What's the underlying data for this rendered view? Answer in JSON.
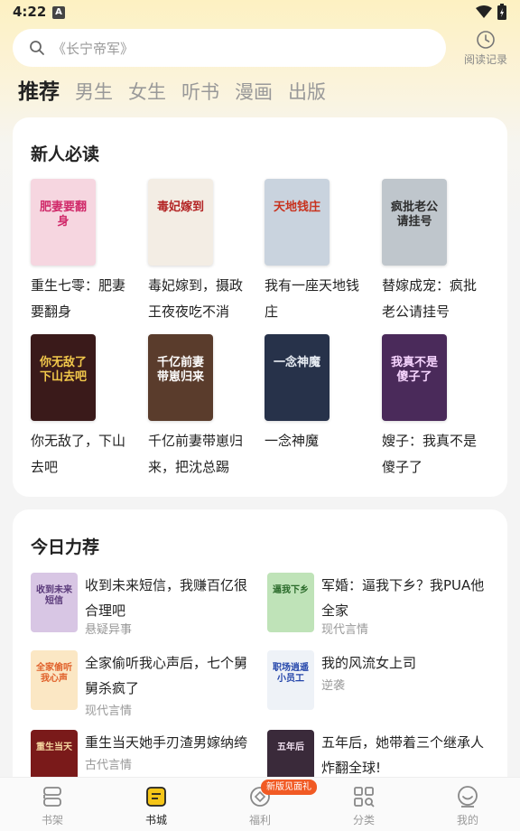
{
  "status": {
    "time": "4:22",
    "notif": "A"
  },
  "search": {
    "placeholder": "《长宁帝军》"
  },
  "history": {
    "label": "阅读记录"
  },
  "channels": [
    "推荐",
    "男生",
    "女生",
    "听书",
    "漫画",
    "出版"
  ],
  "new_reader": {
    "title": "新人必读",
    "books": [
      {
        "title": "重生七零：肥妻要翻身",
        "cover_text": "肥妻要翻身",
        "bg": "#f6d6e0",
        "fg": "#d02a6a"
      },
      {
        "title": "毒妃嫁到，摄政王夜夜吃不消",
        "cover_text": "毒妃嫁到",
        "bg": "#f3ede4",
        "fg": "#b32424"
      },
      {
        "title": "我有一座天地钱庄",
        "cover_text": "天地钱庄",
        "bg": "#c9d3de",
        "fg": "#c8321e"
      },
      {
        "title": "替嫁成宠：疯批老公请挂号",
        "cover_text": "疯批老公请挂号",
        "bg": "#bfc6cc",
        "fg": "#2d2d2d"
      },
      {
        "title": "你无敌了，下山去吧",
        "cover_text": "你无敌了下山去吧",
        "bg": "#3a1a1a",
        "fg": "#f2c84b"
      },
      {
        "title": "千亿前妻带崽归来，把沈总踢出…",
        "cover_text": "千亿前妻带崽归来",
        "bg": "#5a3c2c",
        "fg": "#ffffff"
      },
      {
        "title": "一念神魔",
        "cover_text": "一念神魔",
        "bg": "#27324a",
        "fg": "#e9eef5"
      },
      {
        "title": "嫂子：我真不是傻子了",
        "cover_text": "我真不是傻子了",
        "bg": "#4a2a5a",
        "fg": "#f7d5ff"
      }
    ]
  },
  "today": {
    "title": "今日力荐",
    "items": [
      {
        "title": "收到未来短信，我赚百亿很合理吧",
        "genre": "悬疑异事",
        "cover_text": "收到未来短信",
        "bg": "#d8c6e4",
        "fg": "#5a3a7a"
      },
      {
        "title": "军婚：逼我下乡？我PUA他全家",
        "genre": "现代言情",
        "cover_text": "逼我下乡",
        "bg": "#bfe3b8",
        "fg": "#2a6a2a"
      },
      {
        "title": "全家偷听我心声后，七个舅舅杀疯了",
        "genre": "现代言情",
        "cover_text": "全家偷听我心声",
        "bg": "#fbe7c4",
        "fg": "#e0602a"
      },
      {
        "title": "我的风流女上司",
        "genre": "逆袭",
        "cover_text": "职场逍遥小员工",
        "bg": "#eef2f7",
        "fg": "#2244aa"
      },
      {
        "title": "重生当天她手刃渣男嫁纳绔",
        "genre": "古代言情",
        "cover_text": "重生当天",
        "bg": "#7a1a1a",
        "fg": "#f5d7a0"
      },
      {
        "title": "五年后，她带着三个继承人炸翻全球!",
        "genre": "",
        "cover_text": "五年后",
        "bg": "#3a2a3a",
        "fg": "#f0e0f0"
      }
    ]
  },
  "nav": {
    "items": [
      {
        "label": "书架",
        "icon": "bookshelf-icon"
      },
      {
        "label": "书城",
        "icon": "bookstore-icon"
      },
      {
        "label": "福利",
        "icon": "welfare-icon"
      },
      {
        "label": "分类",
        "icon": "category-icon"
      },
      {
        "label": "我的",
        "icon": "profile-icon"
      }
    ],
    "badge": "新版见面礼"
  },
  "colors": {
    "accent": "#f5c518",
    "badge": "#f15a24"
  }
}
